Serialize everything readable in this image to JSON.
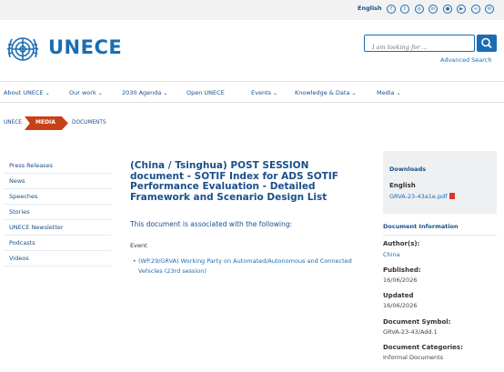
{
  "topbar": {
    "language": "English",
    "social_icons": [
      "facebook-icon",
      "twitter-icon",
      "instagram-icon",
      "linkedin-icon",
      "flickr-icon",
      "youtube-icon",
      "rss-icon",
      "newsletter-icon"
    ]
  },
  "header": {
    "logo_text": "UNECE",
    "search_placeholder": "I am looking for ...",
    "advanced_search": "Advanced Search"
  },
  "nav": {
    "items": [
      {
        "label": "About UNECE",
        "has_dropdown": true
      },
      {
        "label": "Our work",
        "has_dropdown": true
      },
      {
        "label": "2030 Agenda",
        "has_dropdown": true
      },
      {
        "label": "Open UNECE",
        "has_dropdown": false
      },
      {
        "label": "Events",
        "has_dropdown": true
      },
      {
        "label": "Knowledge & Data",
        "has_dropdown": true
      },
      {
        "label": "Media",
        "has_dropdown": true
      }
    ]
  },
  "breadcrumb": {
    "home": "UNECE",
    "current": "MEDIA",
    "last": "DOCUMENTS"
  },
  "sidebar": {
    "items": [
      {
        "label": "Press Releases"
      },
      {
        "label": "News"
      },
      {
        "label": "Speeches"
      },
      {
        "label": "Stories"
      },
      {
        "label": "UNECE Newsletter"
      },
      {
        "label": "Podcasts"
      },
      {
        "label": "Videos"
      }
    ]
  },
  "main": {
    "title": "(China / Tsinghua) POST SESSION document - SOTIF Index for ADS SOTIF Performance Evaluation - Detailed Framework and Scenario Design List",
    "associated": "This document is associated with the following:",
    "event_label": "Event",
    "event_link": "(WP.29/GRVA) Working Party on Automated/Autonomous and Connected Vehicles (23rd session)"
  },
  "downloads": {
    "heading": "Downloads",
    "language": "English",
    "file": "GRVA-23-43a1e.pdf"
  },
  "doc_info": {
    "heading": "Document Information",
    "author_label": "Author(s):",
    "author": "China",
    "published_label": "Published:",
    "published": "16/06/2026",
    "updated_label": "Updated",
    "updated": "16/06/2026",
    "symbol_label": "Document Symbol:",
    "symbol": "GRVA-23-43/Add.1",
    "categories_label": "Document Categories:",
    "categories": "Informal Documents"
  },
  "colors": {
    "brand_blue": "#1a6db3",
    "nav_text": "#1a4f8b",
    "breadcrumb_accent": "#c8401a"
  }
}
